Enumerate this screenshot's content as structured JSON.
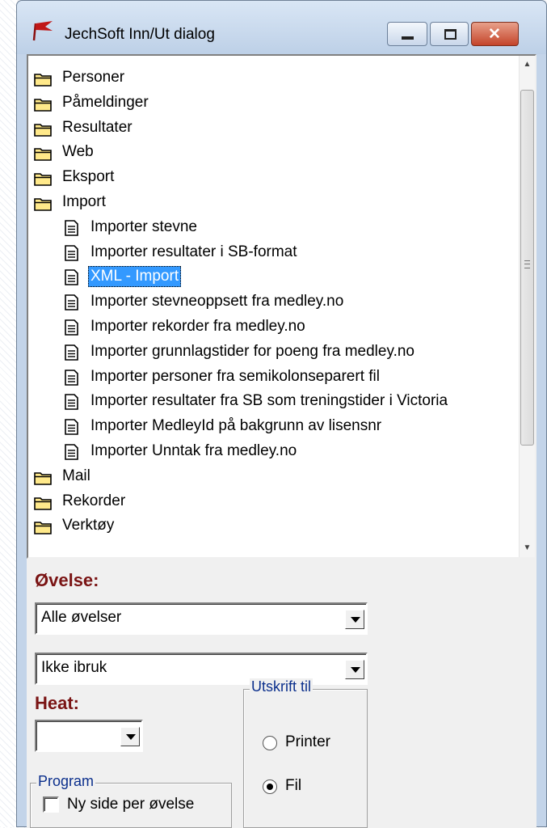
{
  "window": {
    "title": "JechSoft Inn/Ut dialog"
  },
  "tree": {
    "items": [
      {
        "label": "Personer",
        "type": "folder",
        "level": 0
      },
      {
        "label": "Påmeldinger",
        "type": "folder",
        "level": 0
      },
      {
        "label": "Resultater",
        "type": "folder",
        "level": 0
      },
      {
        "label": "Web",
        "type": "folder",
        "level": 0
      },
      {
        "label": "Eksport",
        "type": "folder",
        "level": 0
      },
      {
        "label": "Import",
        "type": "folder",
        "level": 0
      },
      {
        "label": "Importer stevne",
        "type": "document",
        "level": 1
      },
      {
        "label": "Importer resultater i SB-format",
        "type": "document",
        "level": 1
      },
      {
        "label": "XML - Import",
        "type": "document",
        "level": 1,
        "selected": true
      },
      {
        "label": "Importer stevneoppsett fra medley.no",
        "type": "document",
        "level": 1
      },
      {
        "label": "Importer rekorder fra medley.no",
        "type": "document",
        "level": 1
      },
      {
        "label": "Importer grunnlagstider for poeng fra medley.no",
        "type": "document",
        "level": 1
      },
      {
        "label": "Importer personer fra semikolonseparert fil",
        "type": "document",
        "level": 1
      },
      {
        "label": "Importer resultater fra SB som treningstider i Victoria",
        "type": "document",
        "level": 1
      },
      {
        "label": "Importer MedleyId på bakgrunn av lisensnr",
        "type": "document",
        "level": 1
      },
      {
        "label": "Importer Unntak fra medley.no",
        "type": "document",
        "level": 1
      },
      {
        "label": "Mail",
        "type": "folder",
        "level": 0
      },
      {
        "label": "Rekorder",
        "type": "folder",
        "level": 0
      },
      {
        "label": "Verktøy",
        "type": "folder",
        "level": 0
      }
    ]
  },
  "ovelse": {
    "label": "Øvelse:",
    "combo1_value": "Alle øvelser",
    "combo2_value": "Ikke ibruk"
  },
  "heat": {
    "label": "Heat:",
    "value": ""
  },
  "program": {
    "group_title": "Program",
    "checkbox_label": "Ny side per øvelse",
    "checked": false
  },
  "utskrift": {
    "group_title": "Utskrift til",
    "options": [
      {
        "label": "Printer",
        "checked": false
      },
      {
        "label": "Fil",
        "checked": true
      }
    ]
  },
  "colors": {
    "selection": "#3399ff",
    "section_label": "#7a1414",
    "group_title": "#0b2f8c",
    "window_frame": "#c3d4e9"
  },
  "icons": {
    "app": "pennant-icon",
    "folder": "folder-icon",
    "document": "document-icon"
  }
}
